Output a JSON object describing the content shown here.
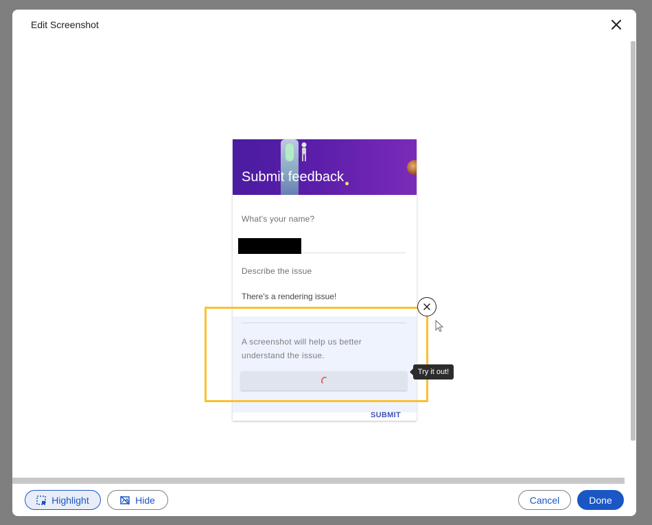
{
  "dialog": {
    "title": "Edit Screenshot"
  },
  "preview": {
    "banner_title": "Submit feedback",
    "name_question": "What's your name?",
    "issue_question": "Describe the issue",
    "issue_value": "There's a rendering issue!",
    "screenshot_hint": "A screenshot will help us better understand the issue.",
    "submit_label": "SUBMIT",
    "tooltip": "Try it out!"
  },
  "toolbar": {
    "highlight_label": "Highlight",
    "hide_label": "Hide",
    "cancel_label": "Cancel",
    "done_label": "Done"
  },
  "colors": {
    "accent": "#1a56c4",
    "selection": "#fbc02d",
    "banner": "#5b1eaa"
  }
}
